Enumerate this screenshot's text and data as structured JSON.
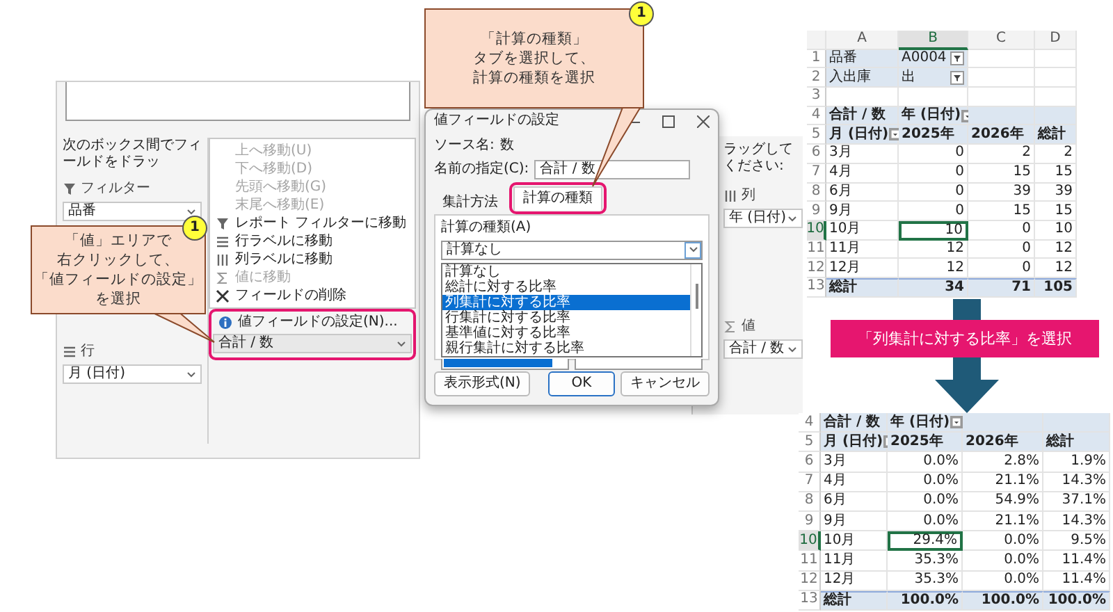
{
  "field_list": {
    "instruction": "次のボックス間でフィールドをドラッ",
    "filter_header": "フィルター",
    "filter_fields": [
      "品番"
    ],
    "rows_header": "行",
    "row_fields": [
      "月 (日付)"
    ],
    "value_fields": [
      "合計 / 数"
    ]
  },
  "context_menu": {
    "items": [
      {
        "label": "上へ移動(U)",
        "disabled": true
      },
      {
        "label": "下へ移動(D)",
        "disabled": true
      },
      {
        "label": "先頭へ移動(G)",
        "disabled": true
      },
      {
        "label": "末尾へ移動(E)",
        "disabled": true
      },
      {
        "label": "レポート フィルターに移動",
        "kind": "filter",
        "disabled": false
      },
      {
        "label": "行ラベルに移動",
        "kind": "rows",
        "disabled": false
      },
      {
        "label": "列ラベルに移動",
        "kind": "columns",
        "disabled": false
      },
      {
        "label": "値に移動",
        "kind": "sigma",
        "disabled": true
      },
      {
        "label": "フィールドの削除",
        "kind": "delete",
        "disabled": false
      },
      {
        "label": "値フィールドの設定(N)...",
        "kind": "info",
        "disabled": false
      }
    ]
  },
  "dialog": {
    "title": "値フィールドの設定",
    "source_label": "ソース名:",
    "source_value": "数",
    "name_label": "名前の指定(C):",
    "name_value": "合計 / 数",
    "tabs": [
      {
        "label": "集計方法",
        "selected": false
      },
      {
        "label": "計算の種類",
        "selected": true
      }
    ],
    "calc_label": "計算の種類(A)",
    "calc_value": "計算なし",
    "calc_options": [
      {
        "label": "計算なし",
        "selected": false
      },
      {
        "label": "総計に対する比率",
        "selected": false
      },
      {
        "label": "列集計に対する比率",
        "selected": true
      },
      {
        "label": "行集計に対する比率",
        "selected": false
      },
      {
        "label": "基準値に対する比率",
        "selected": false
      },
      {
        "label": "親行集計に対する比率",
        "selected": false
      }
    ],
    "buttons": [
      {
        "label": "表示形式(N)",
        "kind": "secondary"
      },
      {
        "label": "OK",
        "kind": "default"
      },
      {
        "label": "キャンセル",
        "kind": "secondary"
      }
    ]
  },
  "column_list": {
    "instruction": "ラッグしてください:",
    "columns_header": "列",
    "column_fields": [
      "年 (日付)"
    ],
    "values_header": "値",
    "value_fields": [
      "合計 / 数"
    ]
  },
  "callouts": [
    {
      "number": "1",
      "lines": [
        "「計算の種類」",
        "タブを選択して、",
        "計算の種類を選択"
      ]
    },
    {
      "number": "1",
      "lines": [
        "「値」エリアで",
        "右クリックして、",
        "「値フィールドの設定」",
        "を選択"
      ]
    }
  ],
  "banner": "「列集計に対する比率」を選択",
  "sheet_before": {
    "column_headers": [
      {
        "label": "A",
        "selected": false
      },
      {
        "label": "B",
        "selected": true
      },
      {
        "label": "C",
        "selected": false
      },
      {
        "label": "D",
        "selected": false
      }
    ],
    "rows": [
      {
        "number": "1",
        "kind": "filter",
        "selected": false,
        "cells": [
          "品番",
          "A0004"
        ]
      },
      {
        "number": "2",
        "kind": "filter",
        "selected": false,
        "cells": [
          "入出庫",
          "出"
        ]
      },
      {
        "number": "3",
        "kind": "blank",
        "selected": false
      },
      {
        "number": "4",
        "kind": "pivot_header",
        "selected": false,
        "cells": [
          "合計 / 数",
          "年 (日付)"
        ]
      },
      {
        "number": "5",
        "kind": "column_labels",
        "selected": false,
        "cells": [
          "月 (日付)",
          "2025年",
          "2026年",
          "総計"
        ]
      },
      {
        "number": "6",
        "kind": "data",
        "selected": false,
        "cells": [
          {
            "text": "3月",
            "selected": false
          },
          {
            "text": "0",
            "selected": false
          },
          {
            "text": "2",
            "selected": false
          },
          {
            "text": "2",
            "selected": false
          }
        ]
      },
      {
        "number": "7",
        "kind": "data",
        "selected": false,
        "cells": [
          {
            "text": "4月",
            "selected": false
          },
          {
            "text": "0",
            "selected": false
          },
          {
            "text": "15",
            "selected": false
          },
          {
            "text": "15",
            "selected": false
          }
        ]
      },
      {
        "number": "8",
        "kind": "data",
        "selected": false,
        "cells": [
          {
            "text": "6月",
            "selected": false
          },
          {
            "text": "0",
            "selected": false
          },
          {
            "text": "39",
            "selected": false
          },
          {
            "text": "39",
            "selected": false
          }
        ]
      },
      {
        "number": "9",
        "kind": "data",
        "selected": false,
        "cells": [
          {
            "text": "9月",
            "selected": false
          },
          {
            "text": "0",
            "selected": false
          },
          {
            "text": "15",
            "selected": false
          },
          {
            "text": "15",
            "selected": false
          }
        ]
      },
      {
        "number": "10",
        "kind": "data",
        "selected": true,
        "cells": [
          {
            "text": "10月",
            "selected": false
          },
          {
            "text": "10",
            "selected": true
          },
          {
            "text": "0",
            "selected": false
          },
          {
            "text": "10",
            "selected": false
          }
        ]
      },
      {
        "number": "11",
        "kind": "data",
        "selected": false,
        "cells": [
          {
            "text": "11月",
            "selected": false
          },
          {
            "text": "12",
            "selected": false
          },
          {
            "text": "0",
            "selected": false
          },
          {
            "text": "12",
            "selected": false
          }
        ]
      },
      {
        "number": "12",
        "kind": "data",
        "selected": false,
        "cells": [
          {
            "text": "12月",
            "selected": false
          },
          {
            "text": "12",
            "selected": false
          },
          {
            "text": "0",
            "selected": false
          },
          {
            "text": "12",
            "selected": false
          }
        ]
      },
      {
        "number": "13",
        "kind": "total",
        "selected": false,
        "cells": [
          "総計",
          "34",
          "71",
          "105"
        ]
      }
    ]
  },
  "sheet_after": {
    "rows": [
      {
        "number": "4",
        "kind": "pivot_header",
        "selected": false,
        "cells": [
          "合計 / 数",
          "年 (日付)"
        ]
      },
      {
        "number": "5",
        "kind": "column_labels",
        "selected": false,
        "cells": [
          "月 (日付)",
          "2025年",
          "2026年",
          "総計"
        ]
      },
      {
        "number": "6",
        "kind": "data",
        "selected": false,
        "cells": [
          {
            "text": "3月",
            "selected": false
          },
          {
            "text": "0.0%",
            "selected": false
          },
          {
            "text": "2.8%",
            "selected": false
          },
          {
            "text": "1.9%",
            "selected": false
          }
        ]
      },
      {
        "number": "7",
        "kind": "data",
        "selected": false,
        "cells": [
          {
            "text": "4月",
            "selected": false
          },
          {
            "text": "0.0%",
            "selected": false
          },
          {
            "text": "21.1%",
            "selected": false
          },
          {
            "text": "14.3%",
            "selected": false
          }
        ]
      },
      {
        "number": "8",
        "kind": "data",
        "selected": false,
        "cells": [
          {
            "text": "6月",
            "selected": false
          },
          {
            "text": "0.0%",
            "selected": false
          },
          {
            "text": "54.9%",
            "selected": false
          },
          {
            "text": "37.1%",
            "selected": false
          }
        ]
      },
      {
        "number": "9",
        "kind": "data",
        "selected": false,
        "cells": [
          {
            "text": "9月",
            "selected": false
          },
          {
            "text": "0.0%",
            "selected": false
          },
          {
            "text": "21.1%",
            "selected": false
          },
          {
            "text": "14.3%",
            "selected": false
          }
        ]
      },
      {
        "number": "10",
        "kind": "data",
        "selected": true,
        "cells": [
          {
            "text": "10月",
            "selected": false
          },
          {
            "text": "29.4%",
            "selected": true
          },
          {
            "text": "0.0%",
            "selected": false
          },
          {
            "text": "9.5%",
            "selected": false
          }
        ]
      },
      {
        "number": "11",
        "kind": "data",
        "selected": false,
        "cells": [
          {
            "text": "11月",
            "selected": false
          },
          {
            "text": "35.3%",
            "selected": false
          },
          {
            "text": "0.0%",
            "selected": false
          },
          {
            "text": "11.4%",
            "selected": false
          }
        ]
      },
      {
        "number": "12",
        "kind": "data",
        "selected": false,
        "cells": [
          {
            "text": "12月",
            "selected": false
          },
          {
            "text": "35.3%",
            "selected": false
          },
          {
            "text": "0.0%",
            "selected": false
          },
          {
            "text": "11.4%",
            "selected": false
          }
        ]
      },
      {
        "number": "13",
        "kind": "total",
        "selected": false,
        "cells": [
          "総計",
          "100.0%",
          "100.0%",
          "100.0%"
        ]
      }
    ]
  }
}
